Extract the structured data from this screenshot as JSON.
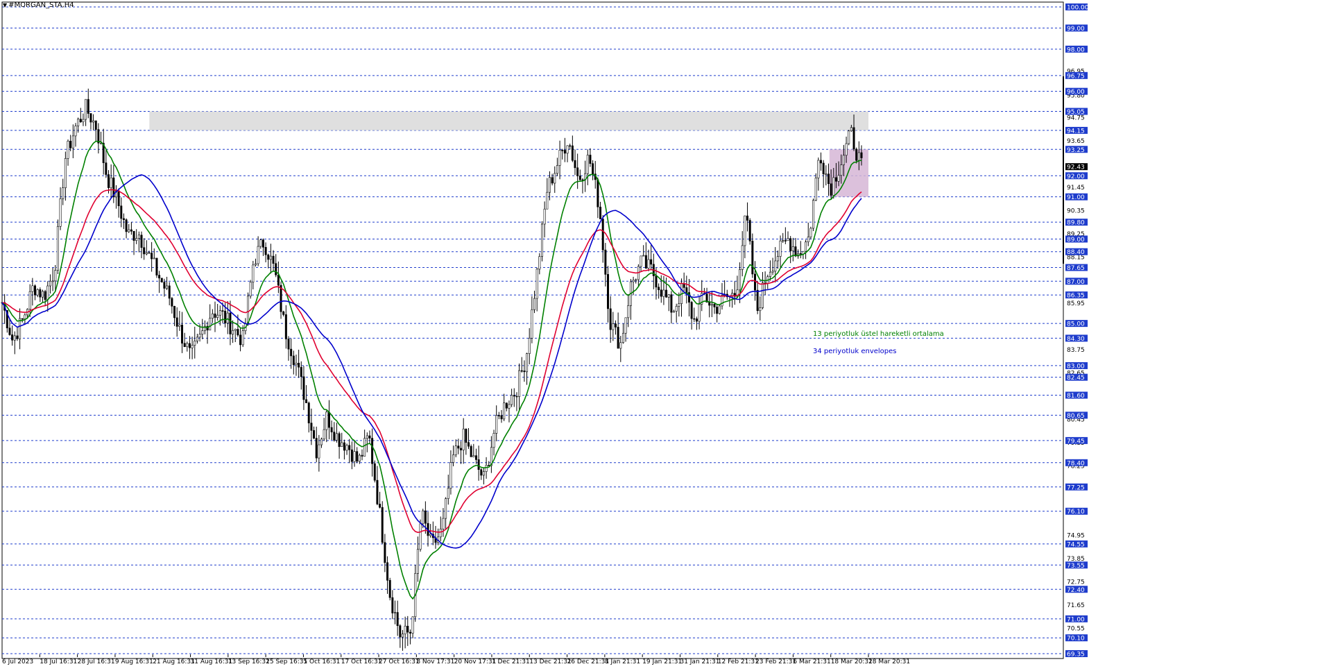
{
  "chart_title": "#MORGAN_STA,H4",
  "chart_data": {
    "type": "candlestick",
    "symbol": "#MORGAN_STA",
    "timeframe": "H4",
    "ylim": [
      69.35,
      100.0
    ],
    "y_gridlines": [
      100.0,
      99.0,
      98.0,
      96.75,
      96.0,
      95.05,
      94.15,
      93.25,
      92.0,
      91.0,
      89.8,
      89.0,
      88.4,
      87.65,
      87.0,
      86.35,
      85.0,
      84.3,
      83.0,
      82.45,
      81.6,
      80.65,
      79.45,
      78.4,
      77.25,
      76.1,
      74.55,
      73.55,
      72.4,
      71.0,
      70.1,
      69.35
    ],
    "y_highlighted_labels": [
      "100.00",
      "99.00",
      "98.00",
      "96.75",
      "96.00",
      "95.05",
      "94.15",
      "93.25",
      "92.00",
      "91.00",
      "89.80",
      "89.00",
      "88.40",
      "87.65",
      "87.00",
      "86.35",
      "85.00",
      "84.30",
      "83.00",
      "82.45",
      "81.60",
      "80.65",
      "79.45",
      "78.40",
      "77.25",
      "76.10",
      "74.55",
      "73.55",
      "72.40",
      "71.00",
      "70.10",
      "69.35"
    ],
    "y_plain_labels": [
      {
        "value": 96.95,
        "text": "96.95"
      },
      {
        "value": 95.8,
        "text": "95.80"
      },
      {
        "value": 94.75,
        "text": "94.75"
      },
      {
        "value": 93.65,
        "text": "93.65"
      },
      {
        "value": 91.45,
        "text": "91.45"
      },
      {
        "value": 90.35,
        "text": "90.35"
      },
      {
        "value": 89.25,
        "text": "89.25"
      },
      {
        "value": 88.15,
        "text": "88.15"
      },
      {
        "value": 85.95,
        "text": "85.95"
      },
      {
        "value": 83.75,
        "text": "83.75"
      },
      {
        "value": 82.65,
        "text": "82.65"
      },
      {
        "value": 80.45,
        "text": "80.45"
      },
      {
        "value": 79.35,
        "text": "79.35"
      },
      {
        "value": 78.25,
        "text": "78.25"
      },
      {
        "value": 74.95,
        "text": "74.95"
      },
      {
        "value": 73.85,
        "text": "73.85"
      },
      {
        "value": 72.75,
        "text": "72.75"
      },
      {
        "value": 71.65,
        "text": "71.65"
      },
      {
        "value": 70.55,
        "text": "70.55"
      }
    ],
    "current_price": "92.43",
    "x_labels": [
      "6 Jul 2023",
      "18 Jul 16:31",
      "28 Jul 16:31",
      "9 Aug 16:31",
      "21 Aug 16:31",
      "31 Aug 16:31",
      "13 Sep 16:31",
      "25 Sep 16:31",
      "5 Oct 16:31",
      "17 Oct 16:31",
      "27 Oct 16:31",
      "8 Nov 17:31",
      "20 Nov 17:31",
      "1 Dec 21:31",
      "13 Dec 21:31",
      "26 Dec 21:31",
      "8 Jan 21:31",
      "19 Jan 21:31",
      "31 Jan 21:31",
      "12 Feb 21:31",
      "23 Feb 21:31",
      "6 Mar 21:31",
      "18 Mar 20:31",
      "28 Mar 20:31"
    ],
    "close_path": [
      86.0,
      84.2,
      85.2,
      86.8,
      86.3,
      87.5,
      92.8,
      94.3,
      95.2,
      94.3,
      92.0,
      90.8,
      89.2,
      89.3,
      88.2,
      87.2,
      86.2,
      84.6,
      83.4,
      84.4,
      85.6,
      85.4,
      84.8,
      84.2,
      88.0,
      88.9,
      87.5,
      84.7,
      83.2,
      81.3,
      79.0,
      80.6,
      79.6,
      79.2,
      78.4,
      79.7,
      76.1,
      72.2,
      70.2,
      70.4,
      76.0,
      74.4,
      75.2,
      78.6,
      79.6,
      78.5,
      77.6,
      80.0,
      81.2,
      81.8,
      83.4,
      87.2,
      91.3,
      92.6,
      93.8,
      91.8,
      92.9,
      90.5,
      85.1,
      84.0,
      86.8,
      87.9,
      87.5,
      86.5,
      85.6,
      86.7,
      85.1,
      86.3,
      85.7,
      86.2,
      86.4,
      90.2,
      85.5,
      87.4,
      88.3,
      89.0,
      88.3,
      89.1,
      93.2,
      91.4,
      92.6,
      94.0,
      92.4
    ],
    "envelope_boxes": [
      {
        "x0": 0.17,
        "x1": 1.0,
        "low": 94.15,
        "high": 95.05,
        "color": "#d9d9d9"
      },
      {
        "x0": 0.955,
        "x1": 1.0,
        "low": 91.0,
        "high": 93.25,
        "color": "#d6b6d6"
      }
    ],
    "series": [
      {
        "name": "13 periyotluk üstel hareketli ortalama",
        "color": "#008000",
        "period": 13
      },
      {
        "name": "ema-slow",
        "color": "#e00030",
        "period": 34
      },
      {
        "name": "34 periyotluk envelopes",
        "color": "#0000cc",
        "period": 34
      }
    ],
    "annotations": [
      "13 periyotluk üstel hareketli ortalama",
      "34 periyotluk envelopes"
    ],
    "colors": {
      "grid": "#1e3ccc",
      "label_bg": "#1e3ccc",
      "candle": "#000000",
      "current_price_bg": "#000000"
    }
  }
}
